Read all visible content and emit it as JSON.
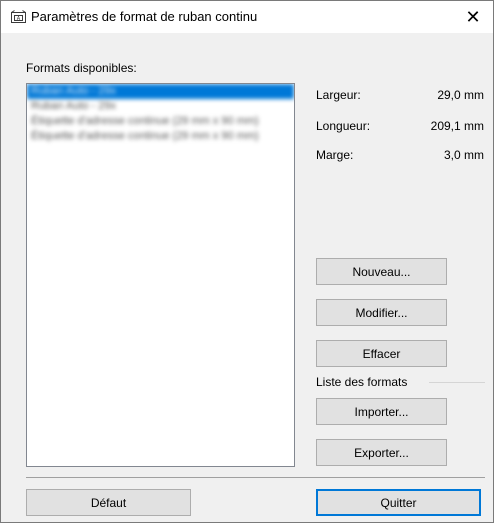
{
  "window": {
    "title": "Paramètres de format de ruban continu",
    "close_glyph": "✕"
  },
  "formats": {
    "label": "Formats disponibles:",
    "items": [
      {
        "label": "Ruban Auto - 29x",
        "selected": true
      },
      {
        "label": "Ruban Auto - 29x",
        "selected": false
      },
      {
        "label": "Étiquette d'adresse continue (29 mm x 90 mm)",
        "selected": false
      },
      {
        "label": "Étiquette d'adresse continue (29 mm x 90 mm)",
        "selected": false
      }
    ]
  },
  "properties": {
    "width_label": "Largeur:",
    "width_value": "29,0 mm",
    "length_label": "Longueur:",
    "length_value": "209,1 mm",
    "margin_label": "Marge:",
    "margin_value": "3,0 mm"
  },
  "buttons": {
    "new": "Nouveau...",
    "modify": "Modifier...",
    "delete": "Effacer",
    "import": "Importer...",
    "export": "Exporter...",
    "default": "Défaut",
    "quit": "Quitter"
  },
  "format_list_group": {
    "label": "Liste des formats"
  },
  "colors": {
    "selection": "#0078d7",
    "dialog_background": "#f0f0f0",
    "button_face": "#e1e1e1"
  }
}
